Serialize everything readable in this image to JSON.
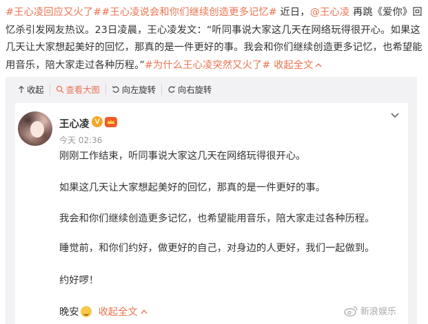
{
  "post": {
    "tag1": "#王心凌回应又火了#",
    "tag2": "#王心凌说会和你们继续创造更多记忆#",
    "text_a": " 近日，",
    "mention": "@王心凌",
    "text_b": " 再跳《爱你》回忆杀引发网友热议。23日凌晨，王心凌发文：“听同事说大家这几天在网络玩得很开心。如果这几天让大家想起美好的回忆，那真的是一件更好的事。我会和你们继续创造更多记忆，也希望能用音乐，陪大家走过各种历程。”",
    "tag3": "#为什么王心凌突然又火了#",
    "collapse_label": " 收起全文"
  },
  "toolbar": {
    "collapse": "收起",
    "view_large": "查看大图",
    "rotate_left": "向左旋转",
    "rotate_right": "向右旋转"
  },
  "image_post": {
    "name": "王心凌",
    "verified_badge": "V",
    "time": "今天 02:36",
    "paragraphs": [
      "刚刚工作结束，听同事说大家这几天在网络玩得很开心。",
      "如果这几天让大家想起美好的回忆，那真的是一件更好的事。",
      "我会和你们继续创造更多记忆，也希望能用音乐，陪大家走过各种历程。",
      "睡觉前，和你们约好，做更好的自己，对身边的人更好，我们一起做到。",
      "约好啰！"
    ],
    "signoff": "晚安",
    "collapse_label": "收起全文"
  },
  "watermark": "新浪娱乐",
  "colors": {
    "accent": "#eb7350",
    "text": "#333333",
    "muted": "#999999",
    "panel": "#f2f2f5",
    "badge": "#f5a623"
  },
  "icons": [
    "collapse-up-icon",
    "search-icon",
    "rotate-left-icon",
    "rotate-right-icon",
    "chevron-down-icon",
    "crown-icon",
    "weibo-logo-icon",
    "sleepy-emoji-icon"
  ]
}
